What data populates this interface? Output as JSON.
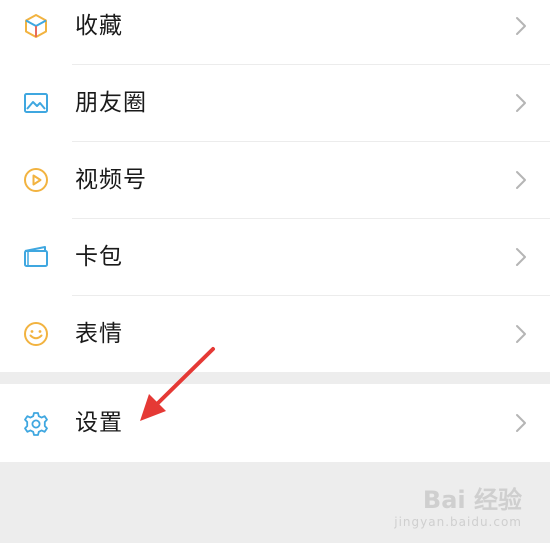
{
  "menu": {
    "items": [
      {
        "label": "收藏",
        "icon": "favorites-cube-icon"
      },
      {
        "label": "朋友圈",
        "icon": "moments-image-icon"
      },
      {
        "label": "视频号",
        "icon": "channels-play-icon"
      },
      {
        "label": "卡包",
        "icon": "card-wallet-icon"
      },
      {
        "label": "表情",
        "icon": "sticker-smile-icon"
      }
    ],
    "settings": {
      "label": "设置",
      "icon": "settings-gear-icon"
    }
  },
  "colors": {
    "background": "#ededed",
    "row": "#ffffff",
    "chevron": "#b5b5b5",
    "arrow": "#e53935"
  },
  "watermark": {
    "main": "Bai 经验",
    "sub": "jingyan.baidu.com"
  }
}
